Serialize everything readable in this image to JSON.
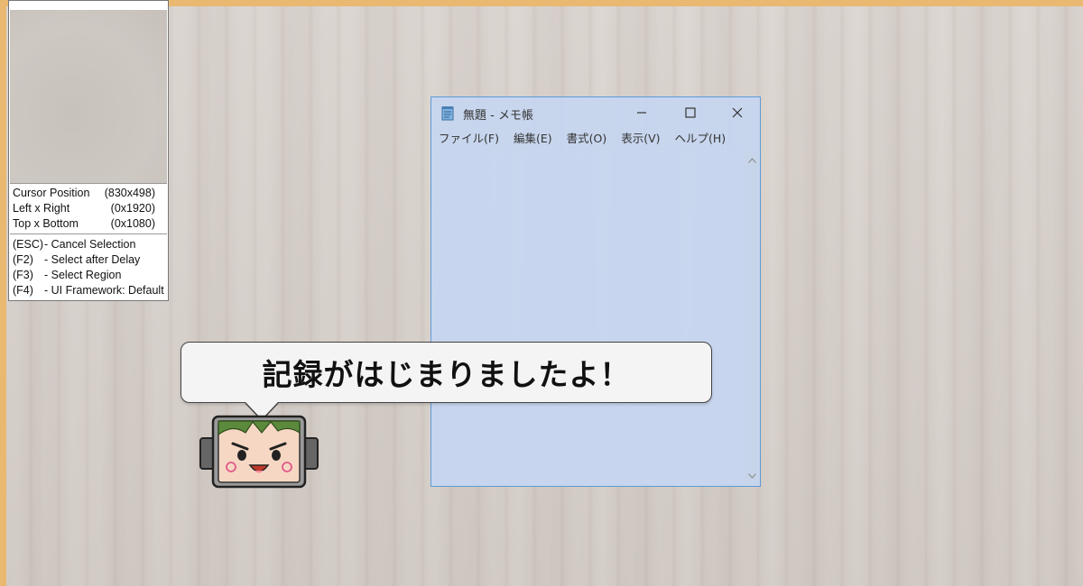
{
  "info_panel": {
    "rows": [
      {
        "label": "Cursor Position",
        "value": "(830x498)"
      },
      {
        "label": "Left x Right",
        "value": "(0x1920)"
      },
      {
        "label": "Top x Bottom",
        "value": "(0x1080)"
      }
    ],
    "shortcuts": [
      {
        "key": "(ESC)",
        "desc": "- Cancel Selection"
      },
      {
        "key": "(F2)",
        "desc": "- Select after Delay"
      },
      {
        "key": "(F3)",
        "desc": "- Select Region"
      },
      {
        "key": "(F4)",
        "desc": "- UI Framework: Default"
      }
    ]
  },
  "notepad": {
    "title": "無題 - メモ帳",
    "menu": [
      "ファイル(F)",
      "編集(E)",
      "書式(O)",
      "表示(V)",
      "ヘルプ(H)"
    ],
    "icons": {
      "app": "notepad-icon",
      "minimize": "minimize-icon",
      "maximize": "maximize-icon",
      "close": "close-icon"
    }
  },
  "bubble": {
    "text": "記録がはじまりましたよ！"
  },
  "colors": {
    "frame": "#e9b871",
    "notepad_bg": "#c6d5ee",
    "notepad_border": "#5f9ad6"
  }
}
